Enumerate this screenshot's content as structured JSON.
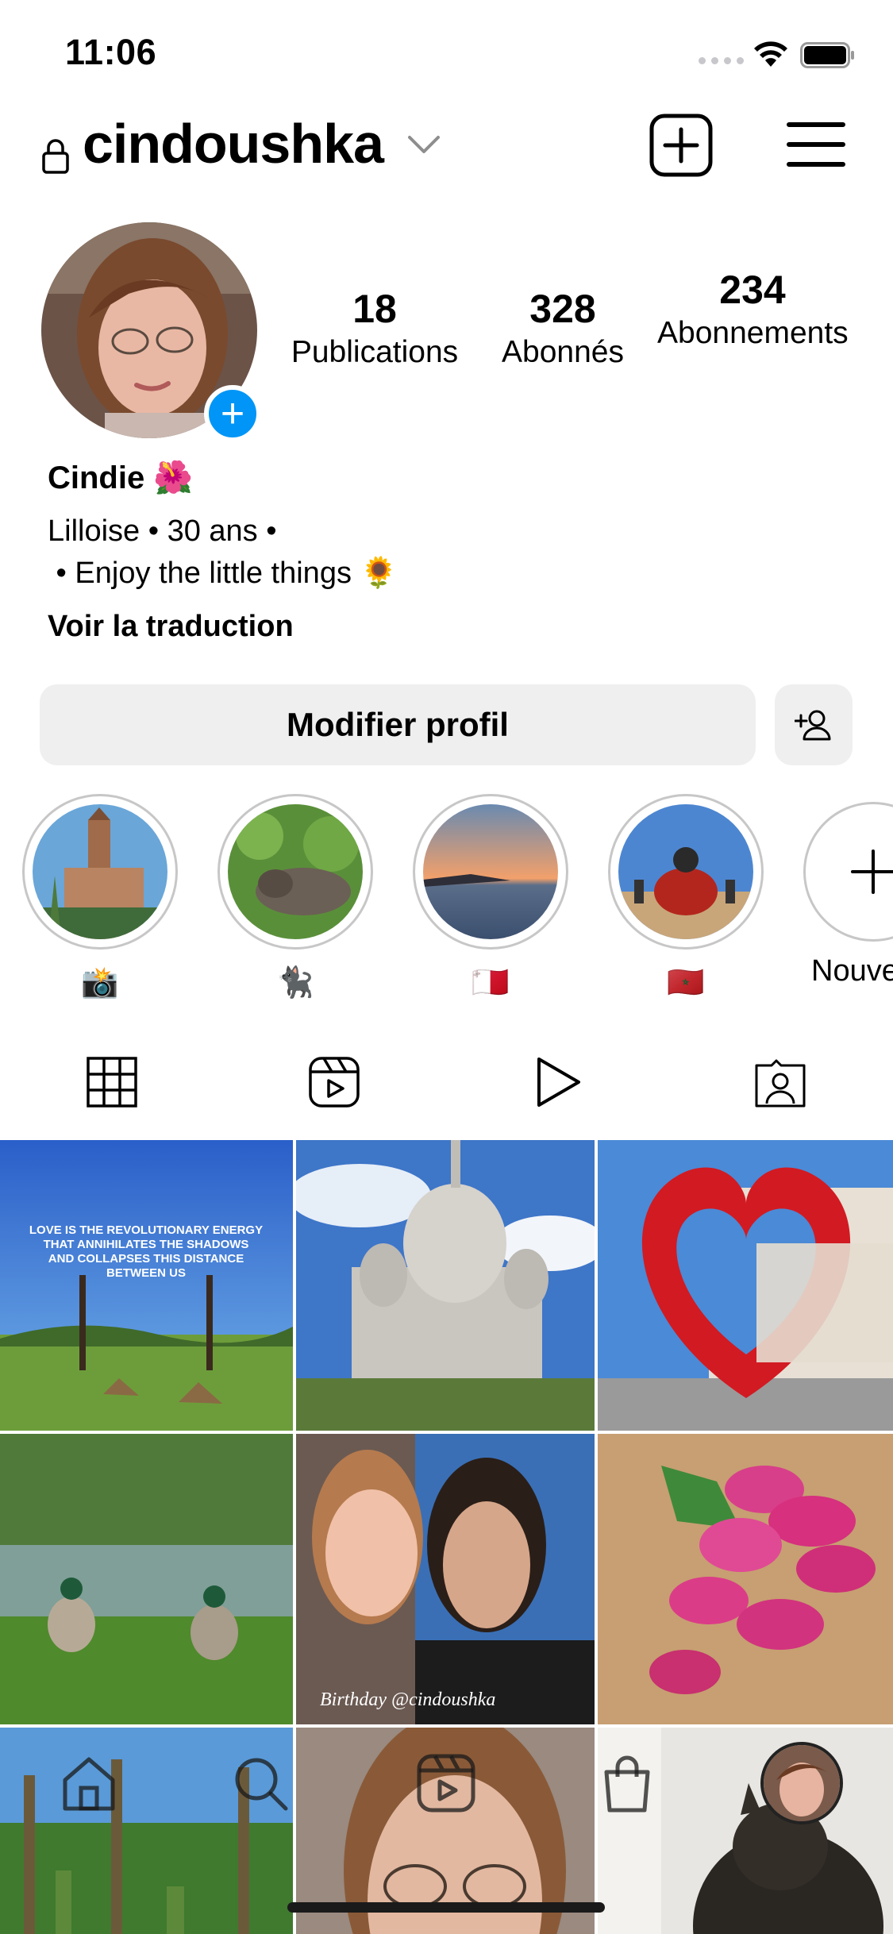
{
  "status_bar": {
    "time": "11:06"
  },
  "header": {
    "username": "cindoushka"
  },
  "profile": {
    "stats": {
      "posts_count": "18",
      "posts_label": "Publications",
      "followers_count": "328",
      "followers_label": "Abonnés",
      "following_count": "234",
      "following_label": "Abonnements"
    },
    "display_name": "Cindie 🌺",
    "bio_line1": "Lilloise • 30 ans •",
    "bio_line2": " • Enjoy the little things 🌻",
    "translate_label": "Voir la traduction",
    "edit_button_label": "Modifier profil"
  },
  "highlights": [
    {
      "label": "📸"
    },
    {
      "label": "🐈‍⬛"
    },
    {
      "label": "🇲🇹"
    },
    {
      "label": "🇲🇦"
    },
    {
      "label": "Nouveau"
    }
  ],
  "tabs": [
    "grid",
    "reels",
    "videos",
    "tagged"
  ],
  "grid_posts": [
    {
      "caption": "LOVE IS THE REVOLUTIONARY ENERGY THAT ANNIHILATES THE SHADOWS AND COLLAPSES THIS DISTANCE BETWEEN US"
    },
    {
      "caption": ""
    },
    {
      "caption": ""
    },
    {
      "caption": ""
    },
    {
      "caption": "Birthday @cindoushka"
    },
    {
      "caption": ""
    },
    {
      "caption": ""
    },
    {
      "caption": ""
    },
    {
      "caption": ""
    }
  ],
  "colors": {
    "accent_blue": "#0095f6",
    "button_gray": "#efefef"
  }
}
